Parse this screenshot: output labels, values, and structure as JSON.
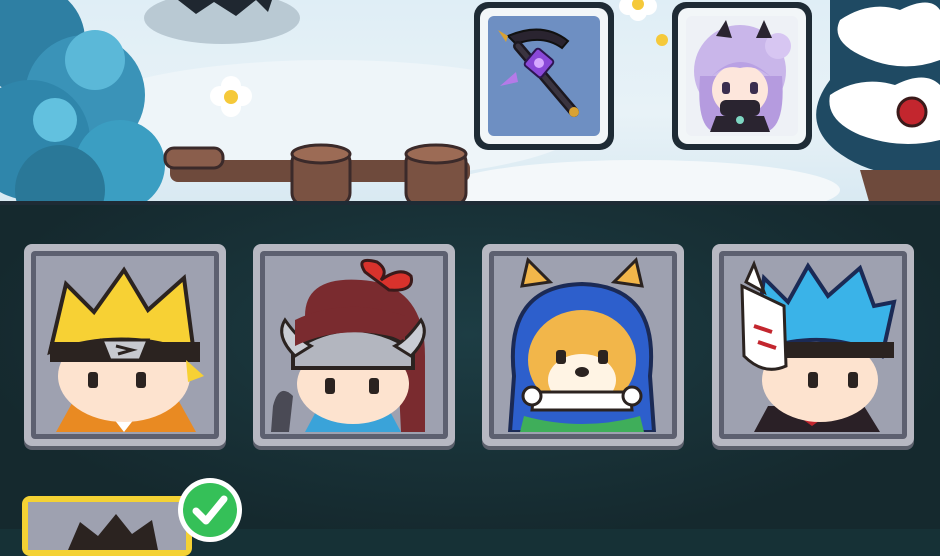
{
  "scene": {
    "equipped": [
      {
        "slot": "weapon",
        "icon": "purple-scythe-icon"
      },
      {
        "slot": "companion",
        "icon": "purple-hair-girl-icon"
      }
    ]
  },
  "heroes": [
    {
      "id": "ninja-yellow-hair",
      "icon": "yellow-hair-ninja-icon"
    },
    {
      "id": "viking-girl",
      "icon": "horned-helmet-girl-icon"
    },
    {
      "id": "shiba-dog",
      "icon": "shiba-dog-hood-icon"
    },
    {
      "id": "fox-mask-ninja",
      "icon": "fox-mask-ninja-icon"
    }
  ],
  "selected": {
    "icon": "checkmark-icon",
    "state": "selected"
  },
  "colors": {
    "panel": "#15292e",
    "card": "#b7b8c2",
    "selected_border": "#f4d234",
    "check": "#35c058"
  }
}
